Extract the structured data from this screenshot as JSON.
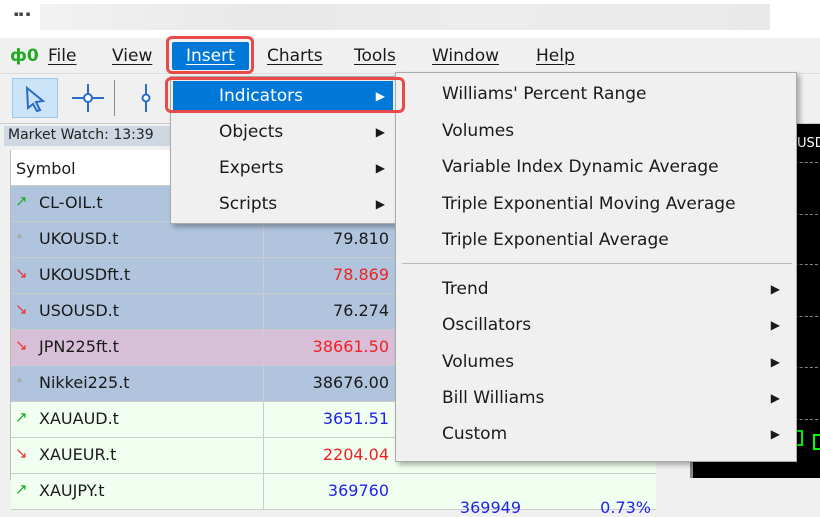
{
  "title": "",
  "menubar": {
    "items": [
      "File",
      "View",
      "Insert",
      "Charts",
      "Tools",
      "Window",
      "Help"
    ],
    "active": "Insert"
  },
  "market_watch": {
    "title": "Market Watch: 13:39",
    "columns": [
      "Symbol"
    ],
    "rows": [
      {
        "symbol": "CL-OIL.t",
        "trend": "up",
        "bid": "",
        "bid_color": "#1a1a1a",
        "bg": "#b0c4de"
      },
      {
        "symbol": "UKOUSD.t",
        "trend": "flat",
        "bid": "79.810",
        "bid_color": "#1a1a1a",
        "bg": "#b0c4de"
      },
      {
        "symbol": "UKOUSDft.t",
        "trend": "down",
        "bid": "78.869",
        "bid_color": "#ee2222",
        "bg": "#b0c4de"
      },
      {
        "symbol": "USOUSD.t",
        "trend": "down",
        "bid": "76.274",
        "bid_color": "#1a1a1a",
        "bg": "#b0c4de"
      },
      {
        "symbol": "JPN225ft.t",
        "trend": "down",
        "bid": "38661.50",
        "bid_color": "#ee2222",
        "bg": "#d8bfd8"
      },
      {
        "symbol": "Nikkei225.t",
        "trend": "flat",
        "bid": "38676.00",
        "bid_color": "#1a1a1a",
        "bg": "#b0c4de"
      },
      {
        "symbol": "XAUAUD.t",
        "trend": "up",
        "bid": "3651.51",
        "bid_color": "#2222ee",
        "bg": "#f0fff0"
      },
      {
        "symbol": "XAUEUR.t",
        "trend": "down",
        "bid": "2204.04",
        "bid_color": "#ee2222",
        "bg": "#f0fff0"
      },
      {
        "symbol": "XAUJPY.t",
        "trend": "up",
        "bid": "369760",
        "bid_color": "#2222ee",
        "bg": "#f0fff0",
        "ask": "369949",
        "change": "0.73%"
      }
    ]
  },
  "chart": {
    "label": "USD"
  },
  "insert_menu": {
    "items": [
      {
        "label": "Indicators",
        "highlighted": true
      },
      {
        "label": "Objects"
      },
      {
        "label": "Experts"
      },
      {
        "label": "Scripts"
      }
    ]
  },
  "indicators_menu": {
    "items": [
      "Williams' Percent Range",
      "Volumes",
      "Variable Index Dynamic Average",
      "Triple Exponential Moving Average",
      "Triple Exponential Average"
    ],
    "submenus": [
      "Trend",
      "Oscillators",
      "Volumes",
      "Bill Williams",
      "Custom"
    ]
  },
  "colors": {
    "highlight": "#0078d7",
    "callout": "#e84a4a",
    "up": "#22aa22",
    "down": "#ee3333"
  }
}
